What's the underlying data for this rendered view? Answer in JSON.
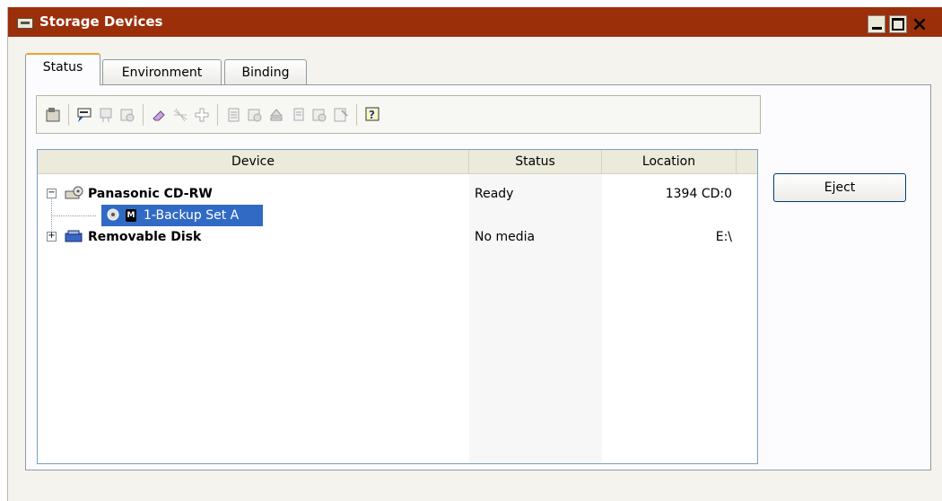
{
  "window": {
    "title": "Storage Devices",
    "controls": {
      "minimize": "minimize",
      "maximize": "maximize",
      "close": "×"
    }
  },
  "tabs": [
    {
      "label": "Status",
      "active": true
    },
    {
      "label": "Environment",
      "active": false
    },
    {
      "label": "Binding",
      "active": false
    }
  ],
  "toolbar": {
    "icons": [
      "properties-icon",
      "comment-icon",
      "unmount-icon",
      "library-icon",
      "eraser-icon",
      "cleaning-icon",
      "add-icon",
      "inventory-icon",
      "label-icon",
      "eject-icon",
      "copy-icon",
      "mount-icon",
      "format-icon",
      "help-icon"
    ]
  },
  "list": {
    "columns": [
      "Device",
      "Status",
      "Location"
    ],
    "rows": [
      {
        "name": "Panasonic CD-RW",
        "status": "Ready",
        "location": "1394 CD:0",
        "expanded": true,
        "icon": "cdrw-drive-icon"
      },
      {
        "name": "1-Backup Set A",
        "badge": "M",
        "status": "",
        "location": "",
        "selected": true,
        "icon": "disc-icon"
      },
      {
        "name": "Removable Disk",
        "status": "No media",
        "location": "E:\\",
        "expanded": false,
        "icon": "removable-disk-icon"
      }
    ]
  },
  "actions": {
    "eject_label": "Eject"
  },
  "colors": {
    "titlebar": "#9b2f0a",
    "selection": "#316ac5",
    "tab_accent": "#e8a33a"
  }
}
